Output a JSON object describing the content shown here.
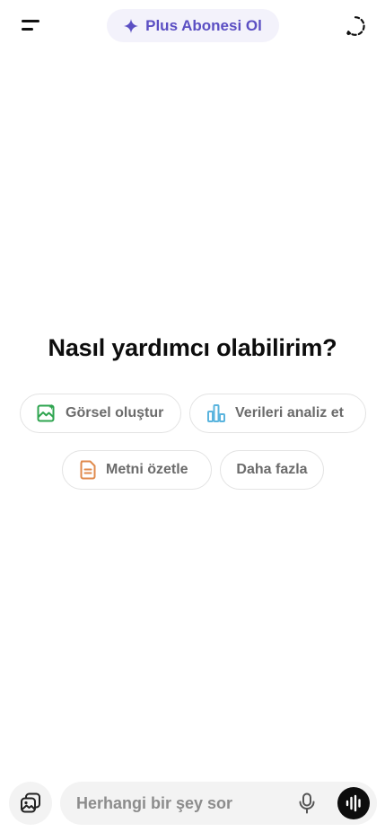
{
  "header": {
    "menu_icon": "menu-icon",
    "upgrade_label": "Plus Abonesi Ol",
    "upgrade_icon": "sparkle-icon",
    "accent_color": "#5b4fc3",
    "new_chat_icon": "new-chat-icon"
  },
  "main": {
    "heading": "Nasıl yardımcı olabilirim?",
    "suggestions": [
      {
        "label": "Görsel oluştur",
        "icon": "image-icon",
        "icon_color": "#2ea44f"
      },
      {
        "label": "Verileri analiz et",
        "icon": "bar-chart-icon",
        "icon_color": "#5ab4de"
      },
      {
        "label": "Metni özetle",
        "icon": "document-icon",
        "icon_color": "#e08a4c"
      },
      {
        "label": "Daha fazla"
      }
    ]
  },
  "composer": {
    "attach_icon": "photos-icon",
    "placeholder": "Herhangi bir şey sor",
    "mic_icon": "microphone-icon",
    "voice_icon": "voice-mode-icon"
  }
}
